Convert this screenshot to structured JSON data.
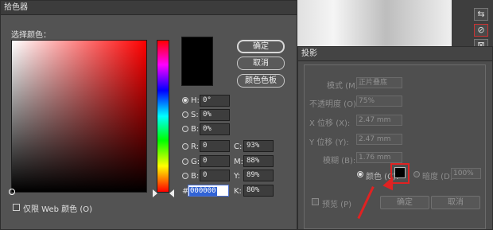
{
  "picker": {
    "title": "拾色器",
    "select_label": "选择颜色：",
    "buttons": {
      "ok": "确定",
      "cancel": "取消",
      "swatches": "颜色色板"
    },
    "fields": {
      "H": {
        "label": "H:",
        "value": "0°"
      },
      "S": {
        "label": "S:",
        "value": "0%"
      },
      "B": {
        "label": "B:",
        "value": "0%"
      },
      "R": {
        "label": "R:",
        "value": "0"
      },
      "G": {
        "label": "G:",
        "value": "0"
      },
      "Bl": {
        "label": "B:",
        "value": "0"
      },
      "C": {
        "label": "C:",
        "value": "93%"
      },
      "M": {
        "label": "M:",
        "value": "88%"
      },
      "Y": {
        "label": "Y:",
        "value": "89%"
      },
      "K": {
        "label": "K:",
        "value": "80%"
      },
      "hex_label": "#",
      "hex_value": "000000"
    },
    "web_only": "仅限 Web 颜色 (O)"
  },
  "shadow": {
    "title": "投影",
    "mode_label": "模式 (M):",
    "mode_value": "正片叠底",
    "opacity_label": "不透明度 (O):",
    "opacity_value": "75%",
    "xoff_label": "X 位移 (X):",
    "xoff_value": "2.47 mm",
    "yoff_label": "Y 位移 (Y):",
    "yoff_value": "2.47 mm",
    "blur_label": "模糊 (B):",
    "blur_value": "1.76 mm",
    "color_label": "颜色 (C):",
    "darkness_label": "暗度 (D):",
    "darkness_value": "100%",
    "preview_label": "预览 (P)",
    "ok": "确定",
    "cancel": "取消"
  },
  "colors": {
    "accent": "#e02222",
    "selected": "#000000"
  }
}
